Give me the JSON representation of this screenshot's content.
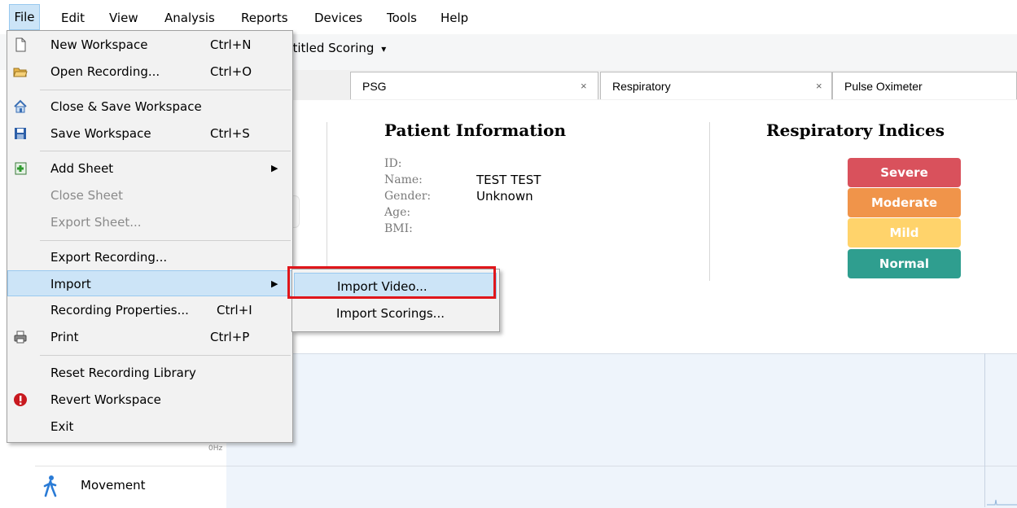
{
  "menubar": {
    "items": [
      "File",
      "Edit",
      "View",
      "Analysis",
      "Reports",
      "Devices",
      "Tools",
      "Help"
    ]
  },
  "toolbar": {
    "scoring_label": "ntitled Scoring",
    "scoring_caret": "▾"
  },
  "tabs": [
    {
      "label": "PSG",
      "close": "×"
    },
    {
      "label": "Respiratory",
      "close": "×"
    },
    {
      "label": "Pulse Oximeter"
    }
  ],
  "patient": {
    "title": "Patient Information",
    "labels": [
      "ID:",
      "Name:",
      "Gender:",
      "Age:",
      "BMI:"
    ],
    "name_value": "TEST TEST",
    "gender_value": "Unknown"
  },
  "respiratory": {
    "title": "Respiratory Indices",
    "badges": [
      {
        "label": "Severe",
        "color": "#d9515c"
      },
      {
        "label": "Moderate",
        "color": "#f0944a"
      },
      {
        "label": "Mild",
        "color": "#ffd36b"
      },
      {
        "label": "Normal",
        "color": "#2f9e8f"
      }
    ]
  },
  "chart": {
    "hz_label": "0Hz",
    "movement_label": "Movement"
  },
  "file_menu": {
    "items": [
      {
        "label": "New Workspace",
        "shortcut": "Ctrl+N",
        "icon": "new-document-icon"
      },
      {
        "label": "Open Recording...",
        "shortcut": "Ctrl+O",
        "icon": "open-folder-icon"
      },
      {
        "label": "Close & Save Workspace",
        "shortcut": "",
        "icon": "home-icon"
      },
      {
        "label": "Save Workspace",
        "shortcut": "Ctrl+S",
        "icon": "floppy-disk-icon"
      },
      {
        "label": "Add Sheet",
        "shortcut": "",
        "icon": "add-sheet-icon",
        "submenu": true
      },
      {
        "label": "Close Sheet",
        "shortcut": "",
        "disabled": true
      },
      {
        "label": "Export Sheet...",
        "shortcut": "",
        "disabled": true
      },
      {
        "label": "Export Recording...",
        "shortcut": ""
      },
      {
        "label": "Import",
        "shortcut": "",
        "submenu": true,
        "highlighted": true
      },
      {
        "label": "Recording Properties...",
        "shortcut": "Ctrl+I"
      },
      {
        "label": "Print",
        "shortcut": "Ctrl+P",
        "icon": "printer-icon"
      },
      {
        "label": "Reset Recording Library",
        "shortcut": ""
      },
      {
        "label": "Revert Workspace",
        "shortcut": "",
        "icon": "warning-icon"
      },
      {
        "label": "Exit",
        "shortcut": ""
      }
    ],
    "arrow": "▶"
  },
  "import_submenu": {
    "items": [
      {
        "label": "Import Video...",
        "highlighted": true
      },
      {
        "label": "Import Scorings..."
      }
    ]
  }
}
